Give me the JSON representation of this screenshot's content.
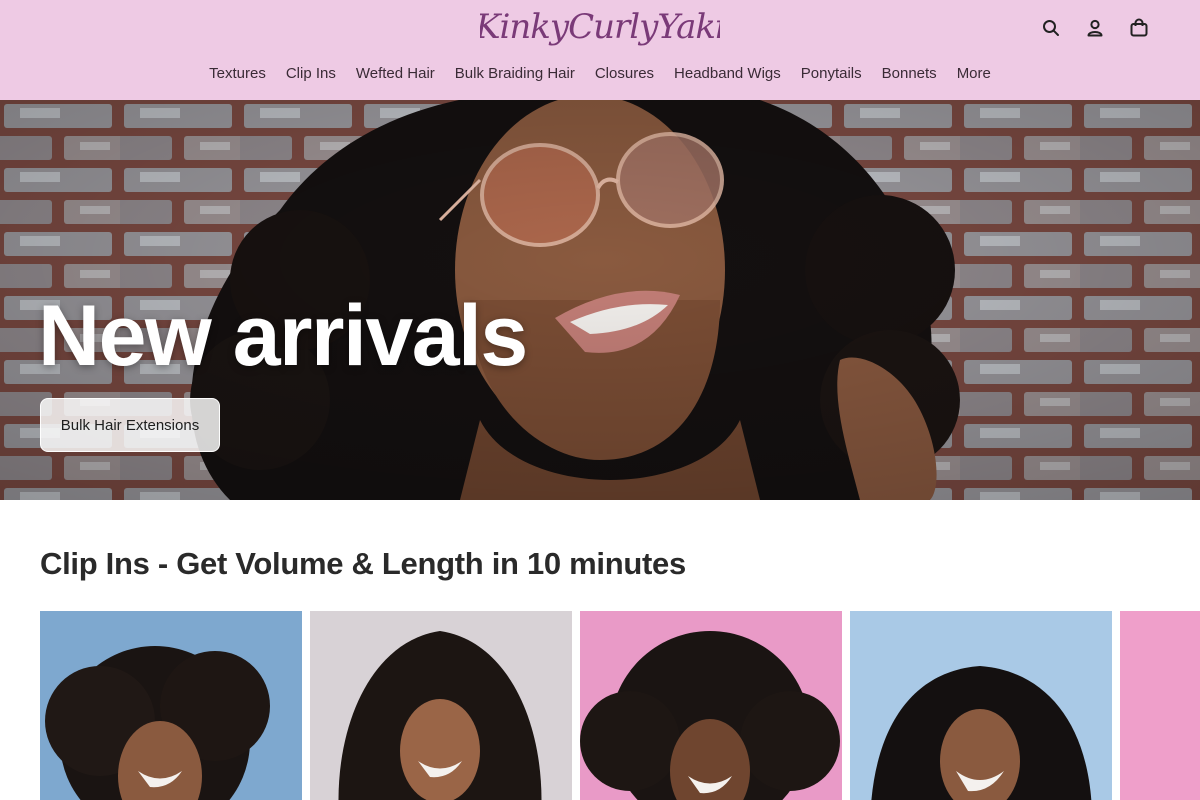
{
  "brand": {
    "logo_text": "KinkyCurlyYaki",
    "logo_color": "#7a3a78"
  },
  "header": {
    "background": "#eecae4",
    "icons": [
      "search-icon",
      "account-icon",
      "cart-icon"
    ]
  },
  "nav": {
    "items": [
      "Textures",
      "Clip Ins",
      "Wefted Hair",
      "Bulk Braiding Hair",
      "Closures",
      "Headband Wigs",
      "Ponytails",
      "Bonnets",
      "More"
    ]
  },
  "hero": {
    "title": "New arrivals",
    "button_label": "Bulk Hair Extensions"
  },
  "section": {
    "title": "Clip Ins - Get Volume & Length in 10 minutes"
  },
  "products": [
    {
      "background": "#7ea8cf"
    },
    {
      "background": "#d8d2d6"
    },
    {
      "background": "#e99ac7"
    },
    {
      "background": "#a9c9e6"
    },
    {
      "background": "#ef9fca"
    }
  ]
}
